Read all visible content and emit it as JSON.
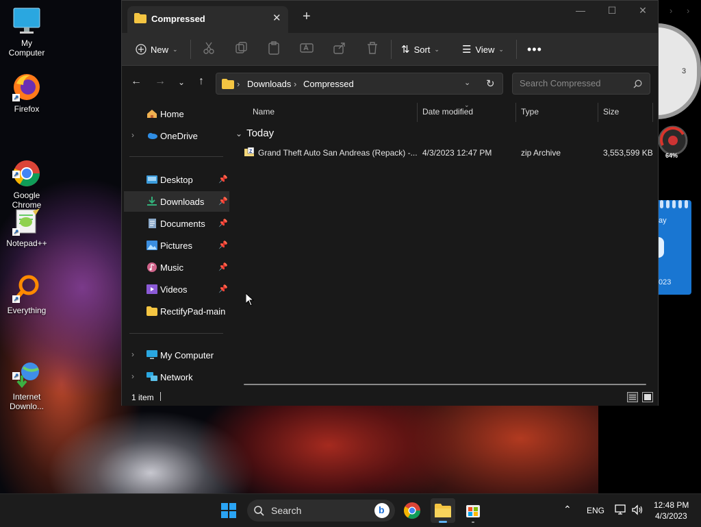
{
  "desktop": {
    "icons": [
      {
        "label": "My Computer"
      },
      {
        "label": "Firefox"
      },
      {
        "label": "Google\nChrome"
      },
      {
        "label": "Notepad++"
      },
      {
        "label": "Everything"
      },
      {
        "label": "Internet\nDownlo..."
      }
    ],
    "widgets": {
      "clock_digit": "3",
      "gauge_percent": "64%",
      "calendar_partial_top": "ay",
      "calendar_partial_bottom": "023"
    }
  },
  "window": {
    "tab_title": "Compressed",
    "toolbar": {
      "new_label": "New",
      "sort_label": "Sort",
      "view_label": "View"
    },
    "address": {
      "crumbs": [
        "Downloads",
        "Compressed"
      ]
    },
    "search": {
      "placeholder": "Search Compressed"
    },
    "nav": {
      "home": "Home",
      "onedrive": "OneDrive",
      "desktop": "Desktop",
      "downloads": "Downloads",
      "documents": "Documents",
      "pictures": "Pictures",
      "music": "Music",
      "videos": "Videos",
      "rectifypad": "RectifyPad-main",
      "mycomputer": "My Computer",
      "network": "Network"
    },
    "columns": {
      "name": "Name",
      "date": "Date modified",
      "type": "Type",
      "size": "Size"
    },
    "group_label": "Today",
    "files": [
      {
        "name": "Grand Theft Auto San Andreas (Repack) -...",
        "date": "4/3/2023 12:47 PM",
        "type": "zip Archive",
        "size": "3,553,599 KB"
      }
    ],
    "status": {
      "item_count": "1 item"
    }
  },
  "taskbar": {
    "search_label": "Search",
    "lang": "ENG",
    "time": "12:48 PM",
    "date": "4/3/2023"
  },
  "colors": {
    "accent": "#0078d4",
    "window_bg": "#191919",
    "toolbar_bg": "#2c2c2c",
    "folder_yellow": "#f4c542"
  }
}
